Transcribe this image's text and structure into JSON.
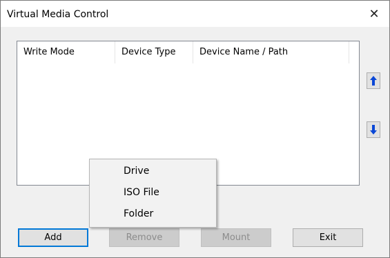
{
  "window": {
    "title": "Virtual Media Control",
    "close_glyph": "✕"
  },
  "list": {
    "columns": [
      "Write Mode",
      "Device Type",
      "Device Name / Path"
    ]
  },
  "side_buttons": {
    "up_icon": "arrow-up-icon",
    "down_icon": "arrow-down-icon"
  },
  "buttons": {
    "add": "Add",
    "remove": "Remove",
    "mount": "Mount",
    "exit": "Exit"
  },
  "context_menu": {
    "items": [
      "Drive",
      "ISO File",
      "Folder"
    ]
  },
  "colors": {
    "accent": "#0078d7",
    "arrow": "#0a47d6"
  }
}
